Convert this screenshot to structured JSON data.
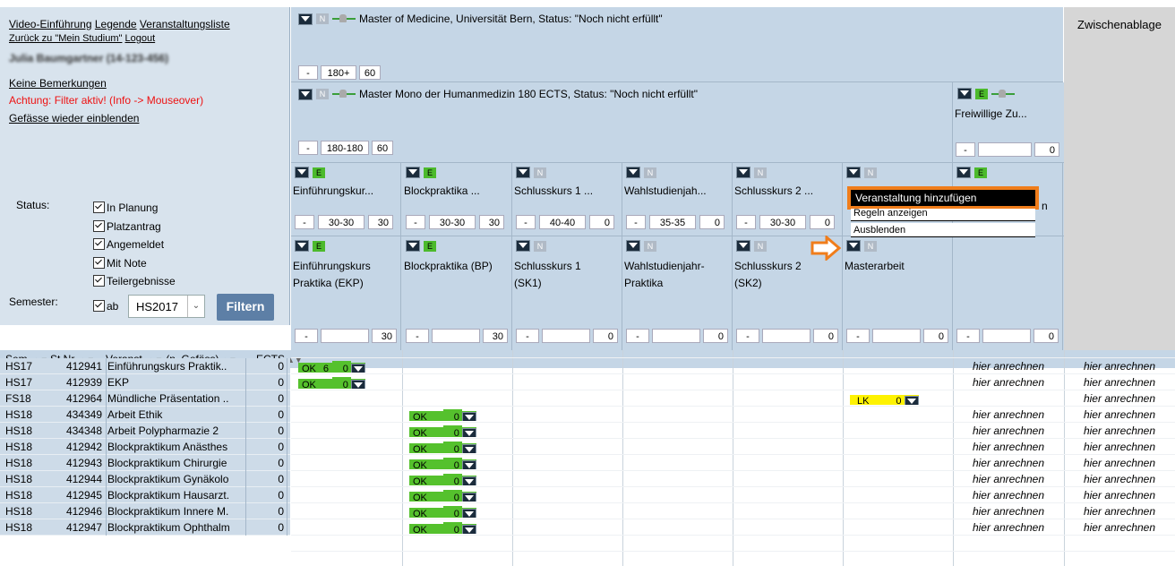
{
  "left": {
    "links_row1": [
      "Video-Einführung",
      "Legende",
      "Veranstaltungsliste"
    ],
    "links_row2": [
      "Zurück zu \"Mein Studium\"",
      "Logout"
    ],
    "user_blurred": "Julia Baumgartner (14-123-456)",
    "keine_bemerkungen": "Keine Bemerkungen",
    "filter_warning": "Achtung: Filter aktiv! (Info -> Mouseover)",
    "gefaesse": "Gefässe wieder einblenden",
    "status_label": "Status:",
    "status_options": [
      "In Planung",
      "Platzantrag",
      "Angemeldet",
      "Mit Note",
      "Teilergebnisse"
    ],
    "semester_label": "Semester:",
    "semester_ab": "ab",
    "semester_value": "HS2017",
    "filter_button": "Filtern"
  },
  "top": {
    "master1_title": "Master of Medicine, Universität Bern, Status: \"Noch nicht erfüllt\"",
    "master1_nums": [
      "-",
      "180+",
      "60"
    ],
    "master2_title": "Master Mono der Humanmedizin 180 ECTS, Status: \"Noch nicht erfüllt\"",
    "master2_nums": [
      "-",
      "180-180",
      "60"
    ],
    "freiwillige_title": "Freiwillige Zu...",
    "freiwillige_nums": [
      "-",
      "",
      "0"
    ],
    "zwischenablage": "Zwischenablage"
  },
  "groups_level1": [
    {
      "badge": "E",
      "title": "Einführungskur...",
      "nums": [
        "-",
        "30-30",
        "30"
      ]
    },
    {
      "badge": "E",
      "title": "Blockpraktika ...",
      "nums": [
        "-",
        "30-30",
        "30"
      ]
    },
    {
      "badge": "N",
      "title": "Schlusskurs 1 ...",
      "nums": [
        "-",
        "40-40",
        "0"
      ]
    },
    {
      "badge": "N",
      "title": "Wahlstudienjah...",
      "nums": [
        "-",
        "35-35",
        "0"
      ]
    },
    {
      "badge": "N",
      "title": "Schlusskurs 2 ...",
      "nums": [
        "-",
        "30-30",
        "0"
      ]
    },
    {
      "badge": "N",
      "title": "",
      "nums": [
        "",
        "",
        ""
      ]
    },
    {
      "badge": "E",
      "title": "",
      "nums": [
        "",
        "",
        ""
      ]
    }
  ],
  "groups_level2": [
    {
      "badge": "E",
      "title1": "Einführungskurs",
      "title2": "Praktika (EKP)",
      "nums": [
        "-",
        "",
        "30"
      ]
    },
    {
      "badge": "E",
      "title1": "Blockpraktika (BP)",
      "title2": "",
      "nums": [
        "-",
        "",
        "30"
      ]
    },
    {
      "badge": "N",
      "title1": "Schlusskurs 1",
      "title2": "(SK1)",
      "nums": [
        "-",
        "",
        "0"
      ]
    },
    {
      "badge": "N",
      "title1": "Wahlstudienjahr-",
      "title2": "Praktika",
      "nums": [
        "-",
        "",
        "0"
      ]
    },
    {
      "badge": "N",
      "title1": "Schlusskurs 2",
      "title2": "(SK2)",
      "nums": [
        "-",
        "",
        "0"
      ]
    },
    {
      "badge": "N",
      "title1": "Masterarbeit",
      "title2": "",
      "nums": [
        "-",
        "",
        "0"
      ]
    },
    {
      "badge": "",
      "title1": "",
      "title2": "",
      "nums": [
        "-",
        "",
        "0"
      ]
    }
  ],
  "hidden_partial": "n",
  "context_menu": [
    "Veranstaltung hinzufügen",
    "Regeln anzeigen",
    "Ausblenden"
  ],
  "table_header": {
    "sem": "Sem.",
    "stnr": "St.Nr.",
    "veranst": "Veranst.",
    "gefaess": "(n. Gefäss)",
    "ects": "ECTS"
  },
  "rows": [
    {
      "sem": "HS17",
      "nr": "412941",
      "name": "Einführungskurs Praktik..",
      "ects": "0",
      "col": 0,
      "status": "OK",
      "a": "6",
      "b": "0",
      "anrechnen": true
    },
    {
      "sem": "HS17",
      "nr": "412939",
      "name": "EKP",
      "ects": "0",
      "col": 0,
      "status": "OK",
      "a": "",
      "b": "0",
      "anrechnen": true
    },
    {
      "sem": "FS18",
      "nr": "412964",
      "name": "Mündliche Präsentation ..",
      "ects": "0",
      "col": 5,
      "status": "LK",
      "a": "",
      "b": "0",
      "anrechnen": false
    },
    {
      "sem": "HS18",
      "nr": "434349",
      "name": "Arbeit Ethik",
      "ects": "0",
      "col": 1,
      "status": "OK",
      "a": "",
      "b": "0",
      "anrechnen": true
    },
    {
      "sem": "HS18",
      "nr": "434348",
      "name": "Arbeit Polypharmazie 2",
      "ects": "0",
      "col": 1,
      "status": "OK",
      "a": "",
      "b": "0",
      "anrechnen": true
    },
    {
      "sem": "HS18",
      "nr": "412942",
      "name": "Blockpraktikum Anästhes",
      "ects": "0",
      "col": 1,
      "status": "OK",
      "a": "",
      "b": "0",
      "anrechnen": true
    },
    {
      "sem": "HS18",
      "nr": "412943",
      "name": "Blockpraktikum Chirurgie",
      "ects": "0",
      "col": 1,
      "status": "OK",
      "a": "",
      "b": "0",
      "anrechnen": true
    },
    {
      "sem": "HS18",
      "nr": "412944",
      "name": "Blockpraktikum Gynäkolo",
      "ects": "0",
      "col": 1,
      "status": "OK",
      "a": "",
      "b": "0",
      "anrechnen": true
    },
    {
      "sem": "HS18",
      "nr": "412945",
      "name": "Blockpraktikum Hausarzt.",
      "ects": "0",
      "col": 1,
      "status": "OK",
      "a": "",
      "b": "0",
      "anrechnen": true
    },
    {
      "sem": "HS18",
      "nr": "412946",
      "name": "Blockpraktikum Innere M.",
      "ects": "0",
      "col": 1,
      "status": "OK",
      "a": "",
      "b": "0",
      "anrechnen": true
    },
    {
      "sem": "HS18",
      "nr": "412947",
      "name": "Blockpraktikum Ophthalm",
      "ects": "0",
      "col": 1,
      "status": "OK",
      "a": "",
      "b": "0",
      "anrechnen": true
    }
  ],
  "anrechnen_label": "hier anrechnen",
  "colors": {
    "panel": "#c5d6e6",
    "ok": "#55c12d",
    "lk": "#fef200",
    "menu_accent": "#f07d1b",
    "filter_btn": "#5d7fa6"
  }
}
